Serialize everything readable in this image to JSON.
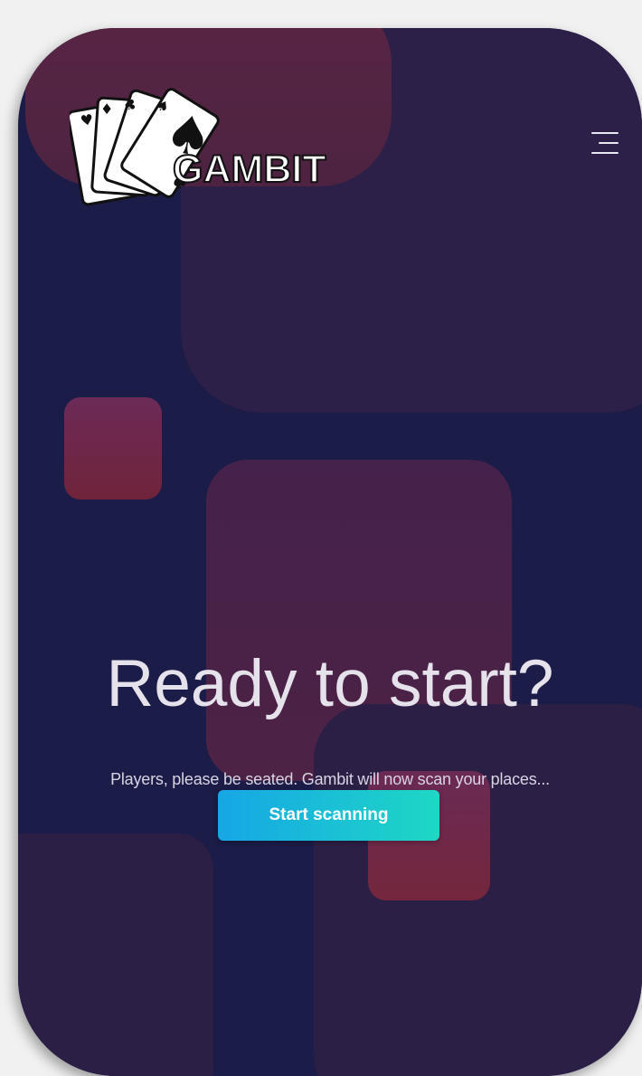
{
  "header": {
    "brand": "GAMBIT",
    "logo_icon": "playing-cards-logo",
    "menu_icon": "hamburger-menu-icon"
  },
  "hero": {
    "title": "Ready to start?",
    "subtitle": "Players, please be seated. Gambit will now scan your places...",
    "cta_label": "Start scanning"
  },
  "colors": {
    "background": "#1b1c47",
    "blob_purple": "#2c1f48",
    "blob_red": "#70243a",
    "cta_start": "#16a6e6",
    "cta_end": "#1ed8c4"
  }
}
